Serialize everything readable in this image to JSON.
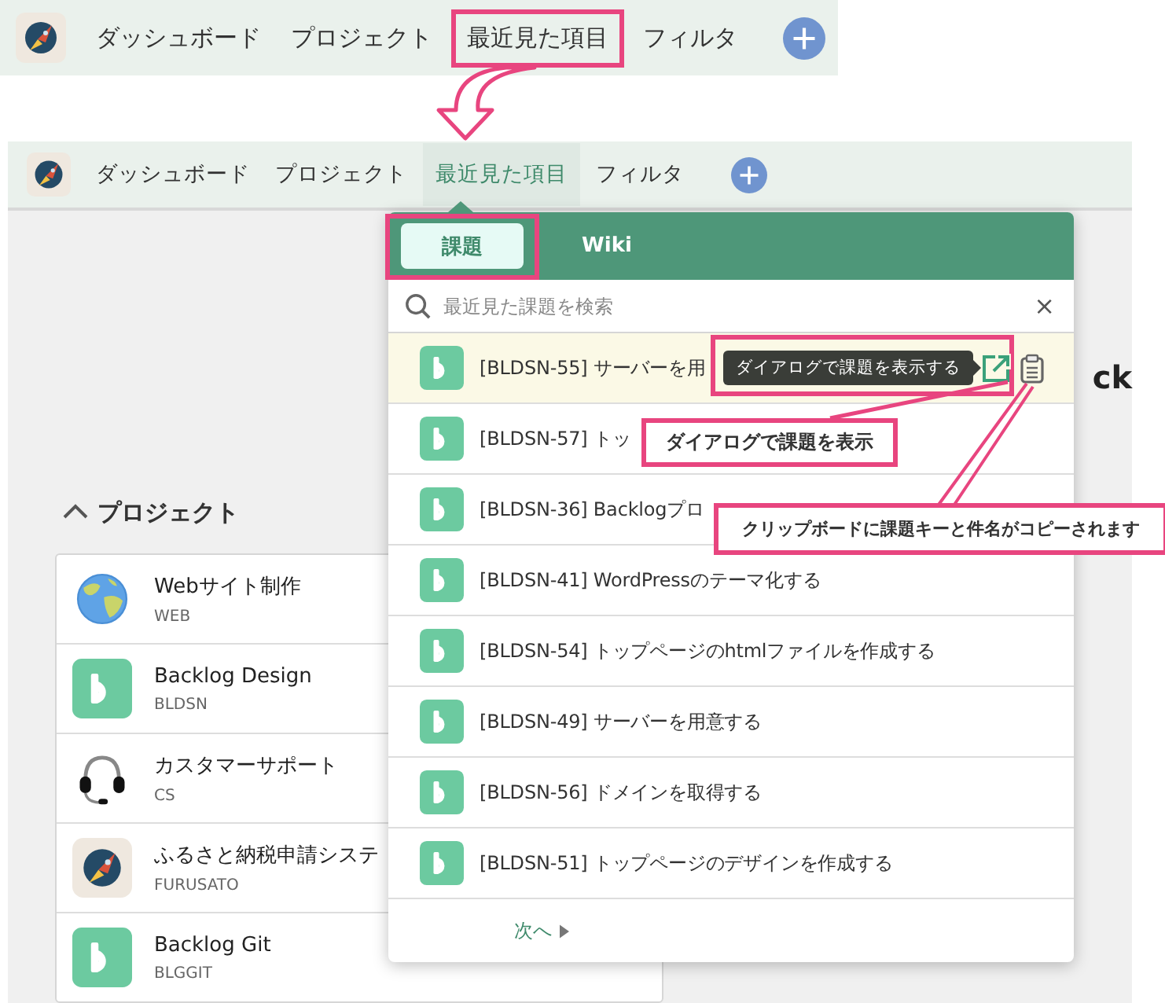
{
  "top_nav": {
    "items": [
      {
        "label": "ダッシュボード",
        "selected": false,
        "highlighted": false
      },
      {
        "label": "プロジェクト",
        "selected": false,
        "highlighted": false
      },
      {
        "label": "最近見た項目",
        "selected": false,
        "highlighted": true
      },
      {
        "label": "フィルタ",
        "selected": false,
        "highlighted": false
      }
    ]
  },
  "nav": {
    "items": [
      {
        "label": "ダッシュボード",
        "selected": false
      },
      {
        "label": "プロジェクト",
        "selected": false
      },
      {
        "label": "最近見た項目",
        "selected": true
      },
      {
        "label": "フィルタ",
        "selected": false
      }
    ]
  },
  "main": {
    "heading_fragment": "ck",
    "section": {
      "title": "プロジェクト",
      "expanded": true
    },
    "projects": [
      {
        "name": "Webサイト制作",
        "key": "WEB",
        "kind": "globe"
      },
      {
        "name": "Backlog Design",
        "key": "BLDSN",
        "kind": "backlog"
      },
      {
        "name": "カスタマーサポート",
        "key": "CS",
        "kind": "headset"
      },
      {
        "name": "ふるさと納税申請システ",
        "key": "FURUSATO",
        "kind": "rocket"
      },
      {
        "name": "Backlog Git",
        "key": "BLGGIT",
        "kind": "backlog"
      }
    ]
  },
  "recent_panel": {
    "tabs": [
      {
        "label": "課題",
        "selected": true,
        "highlighted": true
      },
      {
        "label": "Wiki",
        "selected": false,
        "highlighted": false
      }
    ],
    "search": {
      "placeholder": "最近見た課題を検索"
    },
    "clear": "×",
    "issues": [
      {
        "label": "[BLDSN-55] サーバーを用",
        "hovered": true,
        "tooltip": "ダイアログで課題を表示する"
      },
      {
        "label": "[BLDSN-57] トッ",
        "hovered": false
      },
      {
        "label": "[BLDSN-36] Backlogプロ",
        "hovered": false
      },
      {
        "label": "[BLDSN-41] WordPressのテーマ化する",
        "hovered": false
      },
      {
        "label": "[BLDSN-54] トップページのhtmlファイルを作成する",
        "hovered": false
      },
      {
        "label": "[BLDSN-49] サーバーを用意する",
        "hovered": false
      },
      {
        "label": "[BLDSN-56] ドメインを取得する",
        "hovered": false
      },
      {
        "label": "[BLDSN-51] トップページのデザインを作成する",
        "hovered": false
      }
    ],
    "next": "次へ"
  },
  "callouts": [
    {
      "text": "ダイアログで課題を表示"
    },
    {
      "text": "クリップボードに課題キーと件名がコピーされます"
    }
  ]
}
